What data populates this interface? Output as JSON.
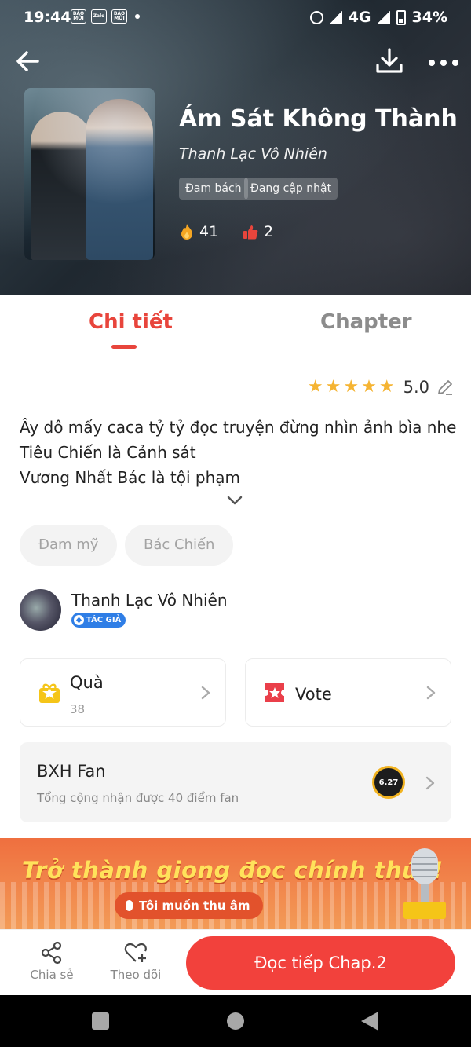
{
  "status_bar": {
    "time": "19:44",
    "app_icons": [
      "BÁO MỚI",
      "Zalo",
      "BÁO MỚI"
    ],
    "network": "4G",
    "battery": "34%"
  },
  "book": {
    "title": "Ám Sát Không Thành",
    "author": "Thanh Lạc Vô Nhiên",
    "tags": [
      "Đam bách",
      "Đang cập nhật"
    ],
    "fire_count": "41",
    "like_count": "2"
  },
  "tabs": {
    "detail": "Chi tiết",
    "chapter": "Chapter",
    "active": "detail"
  },
  "rating": {
    "value": "5.0",
    "stars": 5
  },
  "description": {
    "lines": [
      "Ây dô mấy caca tỷ tỷ đọc truyện đừng nhìn ảnh bìa nhe",
      "Tiêu Chiến là Cảnh sát",
      "Vương Nhất Bác là tội phạm"
    ]
  },
  "chips": [
    "Đam mỹ",
    "Bác Chiến"
  ],
  "author_card": {
    "name": "Thanh Lạc Vô Nhiên",
    "badge": "TÁC GIẢ"
  },
  "gift_card": {
    "label": "Quà",
    "count": "38"
  },
  "vote_card": {
    "label": "Vote"
  },
  "fan_card": {
    "title": "BXH Fan",
    "subtitle": "Tổng cộng nhận được 40 điểm fan",
    "medal_text": "6.27"
  },
  "banner": {
    "title": "Trở thành giọng đọc chính thức!",
    "button": "Tôi muốn thu âm"
  },
  "bottom_bar": {
    "share": "Chia sẻ",
    "follow": "Theo dõi",
    "read_button": "Đọc tiếp Chap.2"
  },
  "colors": {
    "accent": "#e8453c",
    "read_button": "#f2413c",
    "star": "#f5b433",
    "banner": "#ef6f3f"
  }
}
